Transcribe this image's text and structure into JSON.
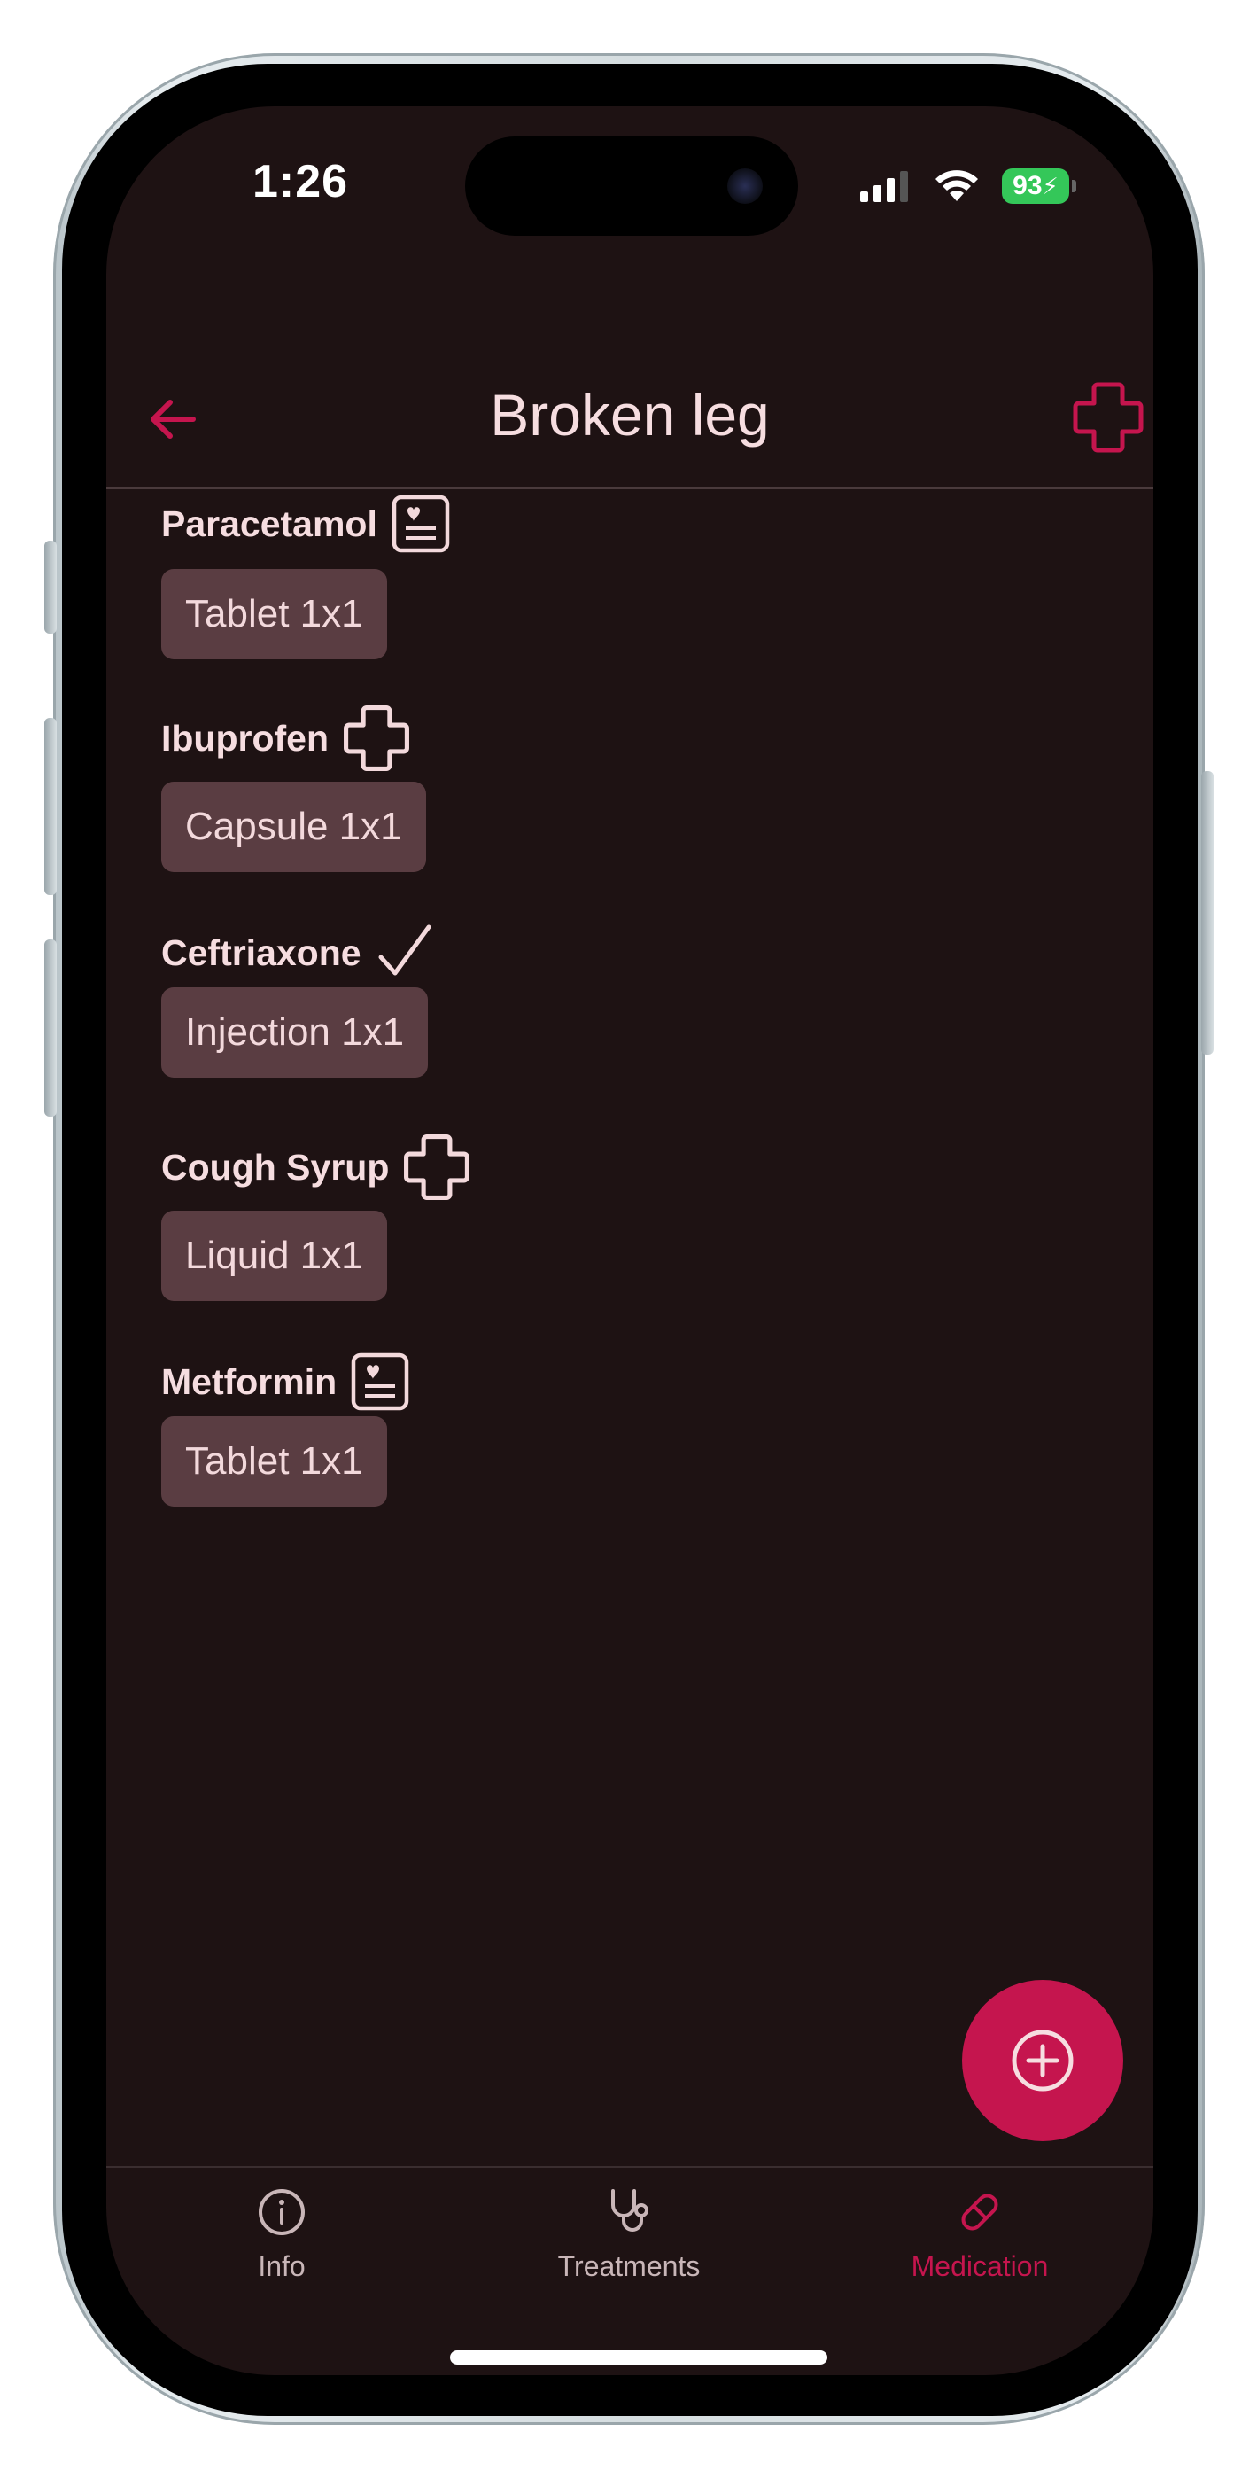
{
  "status_bar": {
    "time": "1:26",
    "battery": "93"
  },
  "app_bar": {
    "title": "Broken leg"
  },
  "medications": [
    {
      "name": "Paracetamol",
      "icon": "medical-record-icon",
      "dose": "Tablet 1x1"
    },
    {
      "name": "Ibuprofen",
      "icon": "plus-cross-icon",
      "dose": "Capsule 1x1"
    },
    {
      "name": "Ceftriaxone",
      "icon": "checkmark-icon",
      "dose": "Injection 1x1"
    },
    {
      "name": "Cough Syrup",
      "icon": "plus-cross-icon",
      "dose": "Liquid 1x1"
    },
    {
      "name": "Metformin",
      "icon": "medical-record-icon",
      "dose": "Tablet 1x1"
    }
  ],
  "bottom_nav": {
    "items": [
      {
        "label": "Info",
        "icon": "info-icon"
      },
      {
        "label": "Treatments",
        "icon": "stethoscope-icon"
      },
      {
        "label": "Medication",
        "icon": "pill-icon",
        "active": true
      }
    ]
  },
  "colors": {
    "background": "#1e1213",
    "accent": "#c5154e",
    "chip": "#5a3d42",
    "text": "#f6dde0",
    "inactive_nav": "#c9b6b8"
  }
}
